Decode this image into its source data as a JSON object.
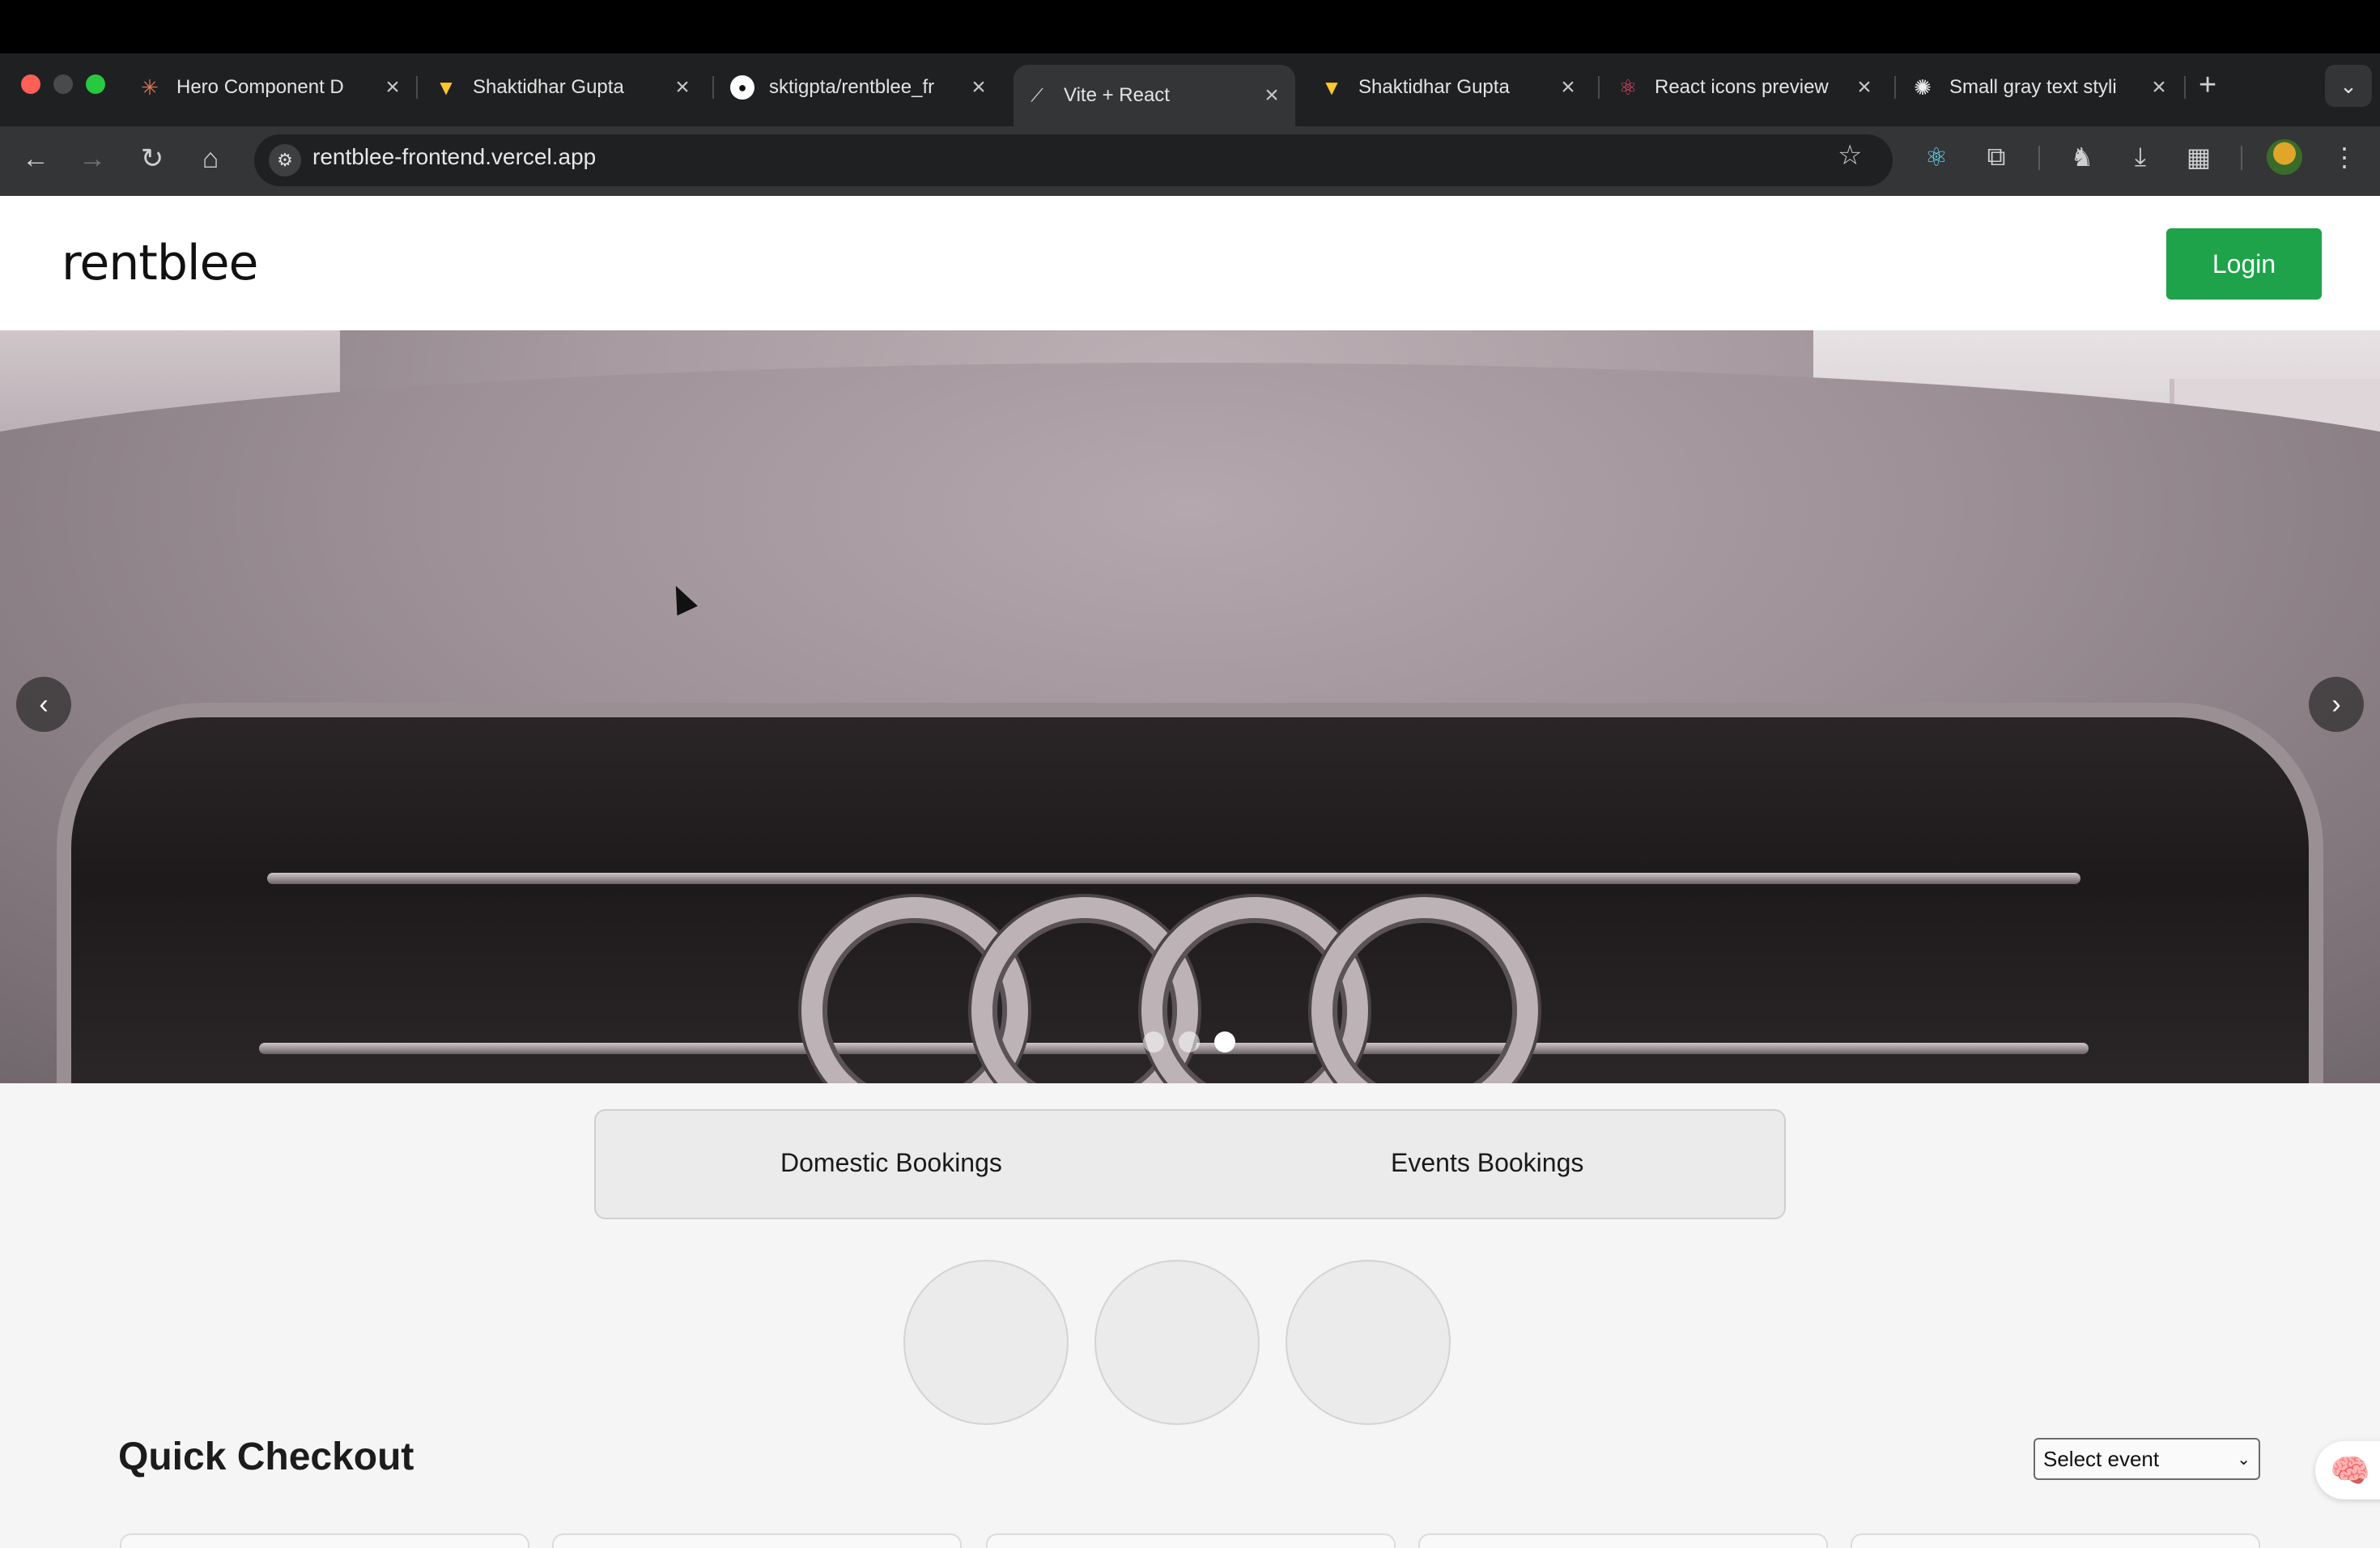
{
  "browser": {
    "tabs": [
      {
        "title": "Hero Component D",
        "favicon": "claude-icon",
        "active": false
      },
      {
        "title": "Shaktidhar Gupta",
        "favicon": "vite-icon",
        "active": false
      },
      {
        "title": "sktigpta/rentblee_fr",
        "favicon": "github-icon",
        "active": false
      },
      {
        "title": "Vite + React",
        "favicon": "trend-icon",
        "active": true
      },
      {
        "title": "Shaktidhar Gupta",
        "favicon": "vite-icon",
        "active": false
      },
      {
        "title": "React icons preview",
        "favicon": "react-icon",
        "active": false
      },
      {
        "title": "Small gray text styli",
        "favicon": "openai-icon",
        "active": false
      }
    ],
    "new_tab_label": "+",
    "url": "rentblee-frontend.vercel.app"
  },
  "site": {
    "logo": "rentblee",
    "login_label": "Login"
  },
  "hero": {
    "prev_label": "‹",
    "next_label": "›",
    "slides_total": 3,
    "active_slide": 3
  },
  "bookings": {
    "tabs": [
      "Domestic Bookings",
      "Events Bookings"
    ]
  },
  "quick_checkout": {
    "title": "Quick Checkout",
    "select_value": "Select event"
  },
  "colors": {
    "login_button": "#1ea24a",
    "tab_bar": "#1f2021",
    "toolbar": "#343536"
  }
}
